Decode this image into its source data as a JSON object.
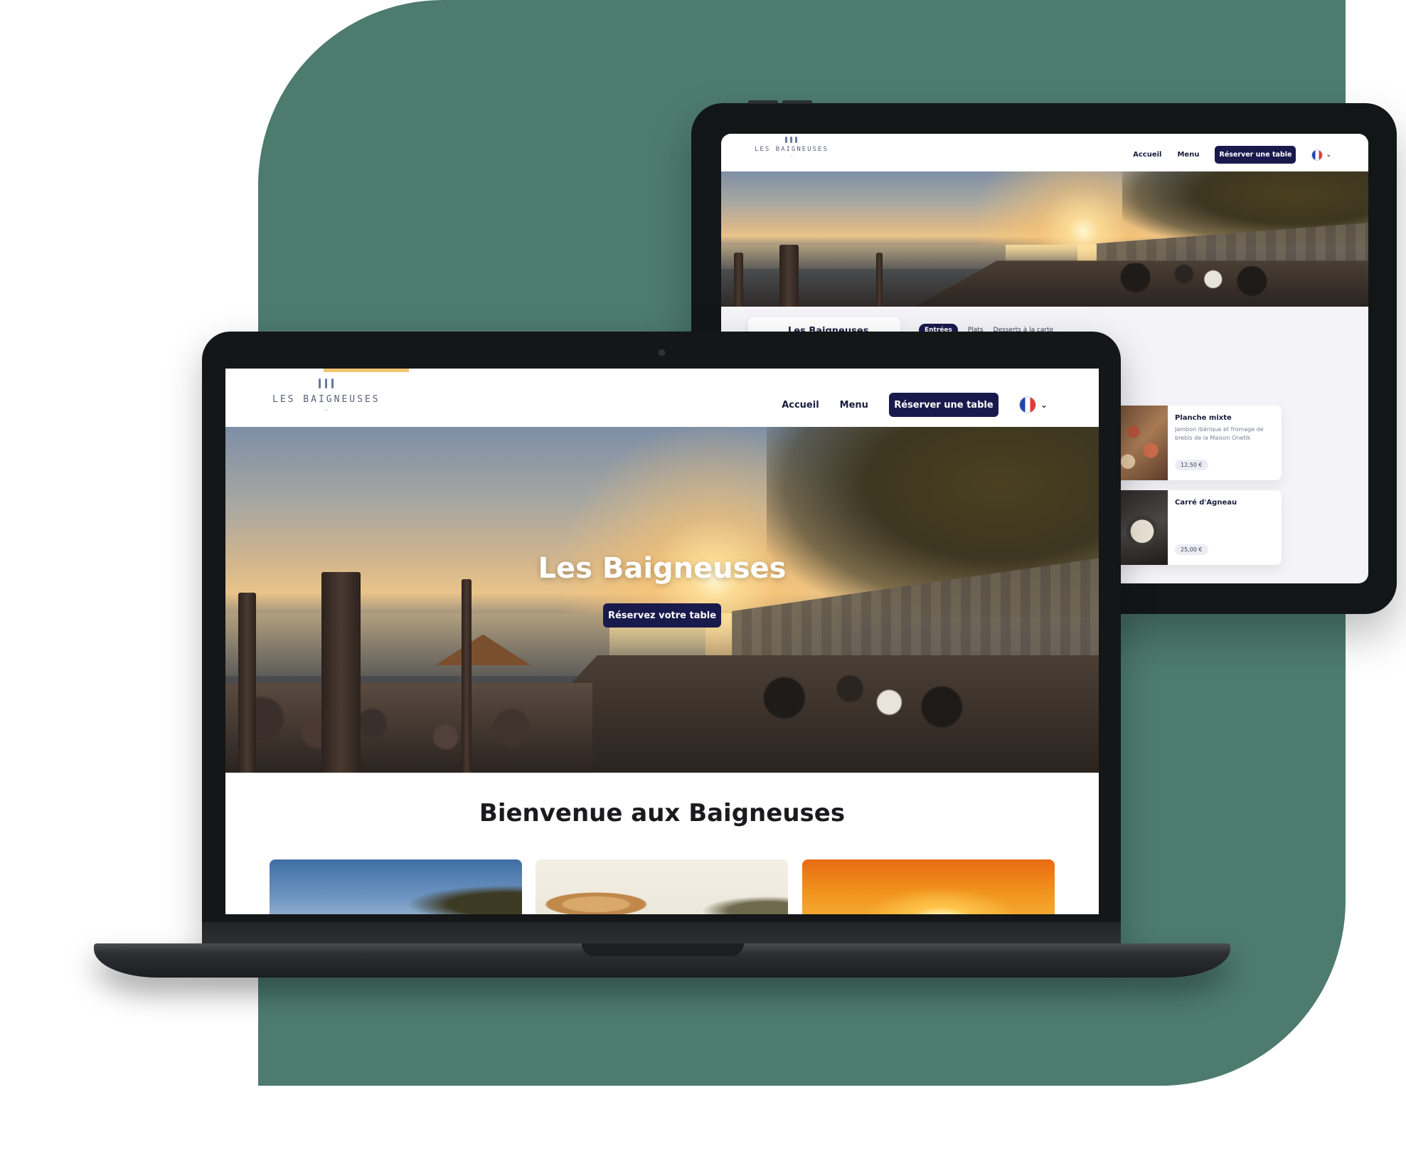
{
  "colors": {
    "backdrop": "#4d7b6e",
    "brand_navy": "#191a4c",
    "accent_yellow": "#f0c470",
    "flag_blue": "#1f45b0",
    "flag_red": "#e13b3b"
  },
  "brand": {
    "name": "LES BAIGNEUSES"
  },
  "tablet": {
    "nav": {
      "accueil": "Accueil",
      "menu": "Menu",
      "cta": "Réserver une table"
    },
    "menu_section": {
      "title": "Les Baigneuses",
      "tabs": [
        "Entrées",
        "Plats",
        "Desserts à la carte"
      ]
    },
    "dishes": [
      {
        "title": "Planche mixte",
        "description": "Jambon ibérique et fromage de brebis de la Maison Onetik",
        "price": "12,50 €"
      },
      {
        "title": "Carré d'Agneau",
        "description": "",
        "price": "25,00 €"
      }
    ]
  },
  "laptop": {
    "nav": {
      "accueil": "Accueil",
      "menu": "Menu",
      "cta": "Réserver une table"
    },
    "hero": {
      "title": "Les Baigneuses",
      "cta": "Réservez votre table"
    },
    "welcome": "Bienvenue aux Baigneuses"
  },
  "icons": {
    "language": "france-flag-icon",
    "dropdown": "chevron-down-icon",
    "camera": "camera-icon"
  }
}
